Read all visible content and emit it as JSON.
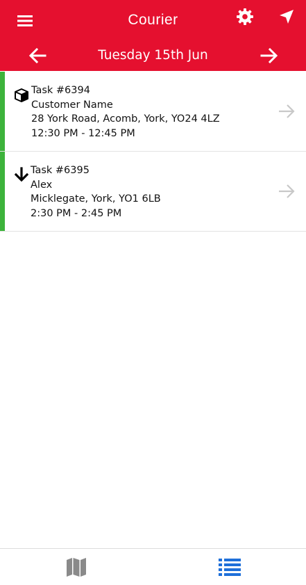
{
  "header": {
    "title": "Courier",
    "date": "Tuesday 15th Jun",
    "menu_icon": "hamburger-menu-icon",
    "settings_icon": "gear-icon",
    "navigate_icon": "navigation-arrow-icon",
    "prev_icon": "arrow-left-icon",
    "next_icon": "arrow-right-icon",
    "background_color": "#e5102f"
  },
  "tasks": [
    {
      "task_label": "Task #6394",
      "name": "Customer Name",
      "address": "28 York Road, Acomb, York, YO24 4LZ",
      "time": "12:30 PM - 12:45 PM",
      "type_icon": "package-box-icon",
      "status_color": "#3db33b"
    },
    {
      "task_label": "Task #6395",
      "name": "Alex",
      "address": "Micklegate, York, YO1 6LB",
      "time": "2:30 PM - 2:45 PM",
      "type_icon": "arrow-down-icon",
      "status_color": "#3db33b"
    }
  ],
  "bottom_nav": {
    "map_icon": "map-icon",
    "list_icon": "list-icon",
    "active_color": "#1e6fd9",
    "inactive_color": "#8a8a8a"
  }
}
